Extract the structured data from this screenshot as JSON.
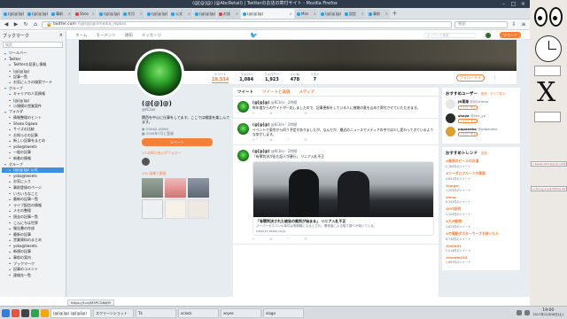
{
  "window": {
    "title": "(@[@]@) (@AbcRetail) | Twitterのお店の寄付サイト - Mozilla Firefox"
  },
  "tabs": [
    {
      "label": "(@[@]@)",
      "color": "#1da1f2"
    },
    {
      "label": "(@[@]@)",
      "color": "#1da1f2"
    },
    {
      "label": "事前",
      "color": "#1da1f2"
    },
    {
      "label": "Shoo",
      "color": "#e03c3c"
    },
    {
      "label": "(@[@]@)",
      "color": "#1da1f2"
    },
    {
      "label": "先月",
      "color": "#1da1f2"
    },
    {
      "label": "(@[@]@)",
      "color": "#1da1f2"
    },
    {
      "label": "公式",
      "color": "#1da1f2"
    },
    {
      "label": "(@[@]@)",
      "color": "#1da1f2"
    },
    {
      "label": "お試",
      "color": "#e03c3c"
    },
    {
      "label": "(@[@]@)",
      "color": "#1da1f2",
      "active": true
    },
    {
      "label": "Mon",
      "color": "#1da1f2"
    },
    {
      "label": "(@[@]@)",
      "color": "#1da1f2"
    },
    {
      "label": "設定",
      "color": "#1da1f2"
    },
    {
      "label": "事前",
      "color": "#1da1f2"
    }
  ],
  "nav": {
    "url_host": "twitter.com",
    "url_path": "/(@[@]@)/media_replies",
    "search_placeholder": "検索"
  },
  "sidebar": {
    "title": "ブックマーク",
    "search_placeholder": "検索",
    "items": [
      {
        "label": "ツールバー",
        "folder": true
      },
      {
        "label": "Twitter",
        "folder": true
      },
      {
        "label": "Twitterの見直し情報",
        "folder": false
      },
      {
        "label": "(@[@]@)",
        "folder": false
      },
      {
        "label": "記事一覧",
        "folder": false
      },
      {
        "label": "お気に入りの検索ワード",
        "folder": false
      },
      {
        "label": "グループ",
        "folder": true
      },
      {
        "label": "キャリアの人気情報",
        "folder": false
      },
      {
        "label": "(@[@]@)",
        "folder": false
      },
      {
        "label": "小規模の営業案件",
        "folder": false
      },
      {
        "label": "フォルダ",
        "folder": true
      },
      {
        "label": "情報整理のヒント",
        "folder": false
      },
      {
        "label": "Shoko Ogawa",
        "folder": false
      },
      {
        "label": "サイズの比較",
        "folder": false
      },
      {
        "label": "お知らせの記事",
        "folder": false
      },
      {
        "label": "新しい記事をまとめ",
        "folder": false
      },
      {
        "label": "yoko@tweets",
        "folder": false
      },
      {
        "label": "一般の記事",
        "folder": false
      },
      {
        "label": "新着の情報",
        "folder": false
      },
      {
        "label": "グループ",
        "folder": true
      },
      {
        "label": "(@[@]@) 公式",
        "folder": false,
        "selected": true
      },
      {
        "label": "yoko@tweets",
        "folder": false
      },
      {
        "label": "お気に入り",
        "folder": false
      },
      {
        "label": "事前登録のページ",
        "folder": false
      },
      {
        "label": "いろいろなこと",
        "folder": false
      },
      {
        "label": "最新の記事一覧",
        "folder": false
      },
      {
        "label": "ライブ配信の情報",
        "folder": false
      },
      {
        "label": "メモの整理",
        "folder": false
      },
      {
        "label": "過去の記事一覧",
        "folder": false
      },
      {
        "label": "こんにちは世界",
        "folder": false
      },
      {
        "label": "報告書の作成",
        "folder": false
      },
      {
        "label": "最新の記事",
        "folder": false
      },
      {
        "label": "営業資料のまとめ",
        "folder": false
      },
      {
        "label": "yoko@tweets",
        "folder": false
      },
      {
        "label": "新規の記事",
        "folder": false
      },
      {
        "label": "事前の案内",
        "folder": false
      },
      {
        "label": "ブックマーク",
        "folder": false
      },
      {
        "label": "記事のコメント",
        "folder": false
      },
      {
        "label": "連絡先一覧",
        "folder": false
      }
    ]
  },
  "status_url": "https://t.co/M3PCG6dJM",
  "twitter": {
    "nav": {
      "home": "ホーム",
      "moments": "モーメント",
      "notifications": "通知",
      "messages": "メッセージ",
      "search_placeholder": "キーワード検索",
      "tweet_button": "ツイート"
    },
    "profile": {
      "name": "(@[@]@)",
      "handle": "@KCblo",
      "bio": "関西を中心に仕事をしてます。ここでは雑談を楽しんでます。",
      "location": "OSAKA JAPAN",
      "joined": "2009年7月に登録",
      "tweet_to": "ツイート",
      "known_followers": "1人の知り合いがフォロー",
      "media": "155 画像と動画"
    },
    "stats": [
      {
        "label": "ツイート",
        "value": "19,534",
        "active": true
      },
      {
        "label": "フォロー",
        "value": "1,084"
      },
      {
        "label": "フォロワー",
        "value": "1,923"
      },
      {
        "label": "いいね",
        "value": "478"
      },
      {
        "label": "リスト",
        "value": "7"
      }
    ],
    "follow_button": "フォローする",
    "timeline_tabs": {
      "tweets": "ツイート",
      "replies": "ツイートと返信",
      "media": "メディア"
    },
    "tweets": [
      {
        "name": "(@[@]@)",
        "handle": "@KCblo · 2時間",
        "text": "昨年度からのサイトが一応しましたので、記事更新をしている人に感謝の意を込めて寄付させていただきます。",
        "acts": [
          "",
          "",
          "",
          ""
        ]
      },
      {
        "name": "(@[@]@)",
        "handle": "@KCblo · 2時間",
        "text": "イベントで東京から伺う予定がありましたが、なんだか、最近のニュースでメディアの中では少し変わってきているような気がします。",
        "acts": [
          "",
          "",
          "",
          ""
        ]
      },
      {
        "name": "(@[@]@)",
        "handle": "@KCblo · 2時間",
        "text": "「有罪判決が出た証人が連行」 リニア入札不正",
        "card_title": "「有罪判決された被告の裁判が始まる」 リニア入札不正",
        "card_desc": "スーパーゼネコンの事件は長期戦になるとされ、関係者による取り調べが続いている。",
        "card_domain": "news.tv-asahi.co.jp",
        "acts": [
          "",
          "",
          "",
          ""
        ]
      }
    ],
    "who_to_follow": {
      "title": "おすすめユーザー",
      "sub": "· 更新 · すべて表示",
      "users": [
        {
          "name": "JR東海",
          "handle": "@JRCentral",
          "button": "フォローする",
          "color": "#e6e6e6"
        },
        {
          "name": "shoya",
          "handle": "@sho_ya",
          "button": "フォローする",
          "color": "#2b2b2b"
        },
        {
          "name": "papaneko",
          "handle": "@papaneko",
          "button": "フォローする",
          "color": "#d8a030"
        }
      ]
    },
    "trends": {
      "title": "おすすめトレンド",
      "sub": "· 変更",
      "items": [
        {
          "name": "#最高のビールのお湯",
          "count": "2,380件のツイート"
        },
        {
          "name": "#ソーダとフルーツの季節",
          "count": "4,891件のツイート"
        },
        {
          "name": "#ungw",
          "count": "1,203件のツイート"
        },
        {
          "name": "#tmg",
          "count": "8,332件のツイート"
        },
        {
          "name": "#MT証明",
          "count": "5,104件のツイート"
        },
        {
          "name": "#九州動物",
          "count": "3,621件のツイート"
        },
        {
          "name": "#の電動ダスターウーズを持ったら",
          "count": "6,744件のツイート"
        },
        {
          "name": "#m0d01",
          "count": "2,014件のツイート"
        },
        {
          "name": "#mooto242",
          "count": "1,887件のツイート"
        }
      ]
    }
  },
  "taskbar": {
    "tasks": [
      {
        "label": "(@[@]@) (@[@]@)",
        "active": true
      },
      {
        "label": "スクリーンショット",
        "active": false
      },
      {
        "label": "Tk",
        "active": false
      },
      {
        "label": "xclock",
        "active": false
      },
      {
        "label": "xeyes",
        "active": false
      },
      {
        "label": "xlogo",
        "active": false
      }
    ],
    "time": "19:00",
    "date": "2017年12月16日(土)"
  },
  "desktop": {
    "logo": "X",
    "notes": [
      "x-tweet-addr@gn@.net@@",
      "ar-tenvy-sup@2016@.2019"
    ]
  }
}
